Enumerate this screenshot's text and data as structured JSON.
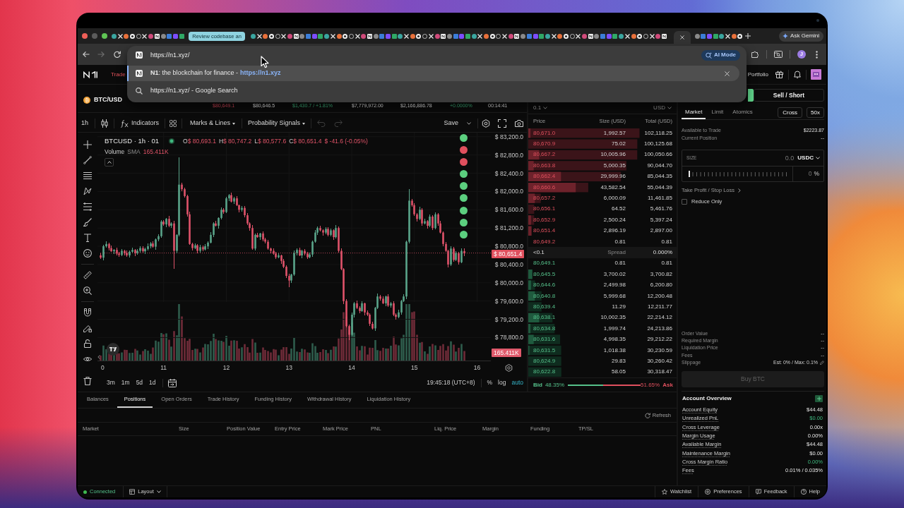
{
  "browser": {
    "tabs": [
      {
        "kind": "favicon",
        "selected": false
      },
      {
        "kind": "favicon",
        "selected": false
      },
      {
        "kind": "favicon",
        "selected": false
      },
      {
        "kind": "favicon",
        "selected": false
      },
      {
        "kind": "favicon",
        "selected": false
      },
      {
        "kind": "favicon",
        "selected": false
      },
      {
        "kind": "favicon",
        "selected": false
      },
      {
        "kind": "favicon",
        "selected": false
      },
      {
        "kind": "favicon",
        "selected": false
      },
      {
        "kind": "favicon",
        "selected": false
      },
      {
        "kind": "favicon",
        "selected": false
      },
      {
        "kind": "favicon",
        "selected": false
      },
      {
        "kind": "group",
        "label": "Review codebase an",
        "selected": false
      },
      {
        "kind": "favicon",
        "selected": false
      },
      {
        "kind": "favicon",
        "selected": false
      },
      {
        "kind": "favicon",
        "selected": false
      },
      {
        "kind": "favicon",
        "selected": false
      },
      {
        "kind": "favicon",
        "selected": false
      },
      {
        "kind": "favicon",
        "selected": false
      },
      {
        "kind": "favicon",
        "selected": false
      },
      {
        "kind": "favicon",
        "selected": false
      },
      {
        "kind": "favicon",
        "selected": false
      },
      {
        "kind": "favicon",
        "selected": false
      },
      {
        "kind": "favicon",
        "selected": false
      },
      {
        "kind": "favicon",
        "selected": false
      },
      {
        "kind": "favicon",
        "selected": false
      },
      {
        "kind": "favicon",
        "selected": false
      },
      {
        "kind": "favicon",
        "selected": false
      },
      {
        "kind": "favicon",
        "selected": false
      },
      {
        "kind": "favicon",
        "selected": false
      },
      {
        "kind": "favicon",
        "selected": false
      },
      {
        "kind": "favicon",
        "selected": false
      },
      {
        "kind": "favicon",
        "selected": false
      },
      {
        "kind": "favicon",
        "selected": false
      },
      {
        "kind": "favicon",
        "selected": false
      },
      {
        "kind": "favicon",
        "selected": false
      },
      {
        "kind": "favicon",
        "selected": false
      },
      {
        "kind": "favicon",
        "selected": false
      },
      {
        "kind": "favicon",
        "selected": false
      },
      {
        "kind": "favicon",
        "selected": false
      },
      {
        "kind": "favicon",
        "selected": false
      },
      {
        "kind": "favicon",
        "selected": false
      },
      {
        "kind": "favicon",
        "selected": false
      },
      {
        "kind": "favicon",
        "selected": false
      },
      {
        "kind": "favicon",
        "selected": false
      },
      {
        "kind": "favicon",
        "selected": false
      },
      {
        "kind": "favicon",
        "selected": false
      },
      {
        "kind": "favicon",
        "selected": false
      },
      {
        "kind": "favicon",
        "selected": false
      },
      {
        "kind": "favicon",
        "selected": false
      },
      {
        "kind": "favicon",
        "selected": false
      },
      {
        "kind": "favicon",
        "selected": false
      },
      {
        "kind": "favicon",
        "selected": false
      },
      {
        "kind": "favicon",
        "selected": false
      },
      {
        "kind": "favicon",
        "selected": false
      },
      {
        "kind": "favicon",
        "selected": false
      },
      {
        "kind": "favicon",
        "selected": false
      },
      {
        "kind": "favicon",
        "selected": false
      },
      {
        "kind": "favicon",
        "selected": false
      },
      {
        "kind": "favicon",
        "selected": false
      },
      {
        "kind": "favicon",
        "selected": false
      },
      {
        "kind": "favicon",
        "selected": false
      },
      {
        "kind": "favicon",
        "selected": false
      },
      {
        "kind": "favicon",
        "selected": false
      },
      {
        "kind": "favicon",
        "selected": false
      },
      {
        "kind": "favicon",
        "selected": false
      },
      {
        "kind": "favicon",
        "selected": false
      },
      {
        "kind": "favicon",
        "selected": false
      },
      {
        "kind": "favicon",
        "selected": false
      },
      {
        "kind": "favicon",
        "selected": false
      },
      {
        "kind": "favicon",
        "selected": false
      },
      {
        "kind": "favicon",
        "selected": false
      },
      {
        "kind": "favicon",
        "selected": false
      },
      {
        "kind": "favicon",
        "selected": false
      },
      {
        "kind": "favicon",
        "selected": false
      },
      {
        "kind": "favicon",
        "selected": false
      },
      {
        "kind": "favicon",
        "selected": false
      },
      {
        "kind": "favicon",
        "selected": false
      },
      {
        "kind": "favicon",
        "selected": false
      },
      {
        "kind": "favicon",
        "selected": false
      },
      {
        "kind": "favicon",
        "selected": false
      },
      {
        "kind": "favicon",
        "selected": true
      },
      {
        "kind": "favicon",
        "selected": false
      },
      {
        "kind": "favicon",
        "selected": false
      },
      {
        "kind": "favicon",
        "selected": false
      },
      {
        "kind": "favicon",
        "selected": false
      },
      {
        "kind": "favicon",
        "selected": false
      },
      {
        "kind": "favicon",
        "selected": false
      },
      {
        "kind": "favicon",
        "selected": false
      },
      {
        "kind": "favicon",
        "selected": false
      }
    ],
    "ask_gemini": "Ask Gemini",
    "back": {
      "disabled": false
    },
    "forward": {
      "disabled": true
    },
    "address": "https://n1.xyz/",
    "ai_mode": "AI Mode",
    "suggestions": [
      {
        "kind": "site",
        "title": "**N1**: the blockchain for finance -",
        "url": "https://n1.xyz",
        "selected": true
      },
      {
        "kind": "search",
        "title": "https://n1.xyz/ - Google Search",
        "selected": false
      }
    ],
    "profile_initial": "J"
  },
  "app_header": {
    "nav_link": {
      "label": "Trade",
      "selected": true
    },
    "portfolio_link": {
      "label": "Portfolio",
      "selected": false
    }
  },
  "market": {
    "symbol": "BTC/USD",
    "stats": [
      {
        "value": "$80,649.1",
        "kind": "down"
      },
      {
        "value": "$80,646.5",
        "kind": "plain"
      },
      {
        "value": "$1,430.7 / +1.81%",
        "kind": "up"
      },
      {
        "value": "$7,779,972.00",
        "kind": "plain"
      },
      {
        "value": "$2,166,886.78",
        "kind": "plain"
      },
      {
        "value": "+0.0000%",
        "kind": "up"
      },
      {
        "value": "00:14:41",
        "kind": "plain"
      }
    ]
  },
  "chart": {
    "toolbar": {
      "interval": "1h",
      "indicators": "Indicators",
      "marks": "Marks & Lines",
      "signals": "Probability Signals",
      "undo": {
        "disabled": true
      },
      "redo": {
        "disabled": true
      },
      "save": "Save"
    },
    "legend": {
      "title": "BTCUSD · 1h · 01",
      "ohlc": [
        {
          "label": "O",
          "value": "$ 80,693.1"
        },
        {
          "label": "H",
          "value": "$ 80,747.2"
        },
        {
          "label": "L",
          "value": "$ 80,577.6"
        },
        {
          "label": "C",
          "value": "$ 80,651.4"
        }
      ],
      "change": "$ -41.6 (-0.05%)",
      "volume": {
        "label": "Volume",
        "indicator": "SMA",
        "value": "165.411K"
      }
    },
    "signal_markers": [
      {
        "color": "#5ccf7f"
      },
      {
        "color": "#e0505e"
      },
      {
        "color": "#e0505e"
      },
      {
        "color": "#5ccf7f"
      },
      {
        "color": "#5ccf7f"
      },
      {
        "color": "#5ccf7f"
      },
      {
        "color": "#5ccf7f"
      },
      {
        "color": "#5ccf7f"
      },
      {
        "color": "#5ccf7f"
      }
    ],
    "chart_data": {
      "type": "candlestick",
      "x": [
        10,
        10.0417,
        10.0833,
        10.125,
        10.1667,
        10.2083,
        10.25,
        10.2917,
        10.3333,
        10.375,
        10.4167,
        10.4583,
        10.5,
        10.5417,
        10.5833,
        10.625,
        10.6667,
        10.7083,
        10.75,
        10.7917,
        10.8333,
        10.875,
        10.9167,
        10.9583,
        11,
        11.0417,
        11.0833,
        11.125,
        11.1667,
        11.2083,
        11.25,
        11.2917,
        11.3333,
        11.375,
        11.4167,
        11.4583,
        11.5,
        11.5417,
        11.5833,
        11.625,
        11.6667,
        11.7083,
        11.75,
        11.7917,
        11.8333,
        11.875,
        11.9167,
        11.9583,
        12,
        12.0417,
        12.0833,
        12.125,
        12.1667,
        12.2083,
        12.25,
        12.2917,
        12.3333,
        12.375,
        12.4167,
        12.4583,
        12.5,
        12.5417,
        12.5833,
        12.625,
        12.6667,
        12.7083,
        12.75,
        12.7917,
        12.8333,
        12.875,
        12.9167,
        12.9583,
        13,
        13.0417,
        13.0833,
        13.125,
        13.1667,
        13.2083,
        13.25,
        13.2917,
        13.3333,
        13.375,
        13.4167,
        13.4583,
        13.5,
        13.5417,
        13.5833,
        13.625,
        13.6667,
        13.7083,
        13.75,
        13.7917,
        13.8333,
        13.875,
        13.9167,
        13.9583,
        14,
        14.0417,
        14.0833,
        14.125,
        14.1667,
        14.2083,
        14.25,
        14.2917,
        14.3333,
        14.375,
        14.4167,
        14.4583,
        14.5,
        14.5417,
        14.5833,
        14.625,
        14.6667,
        14.7083,
        14.75,
        14.7917,
        14.8333,
        14.875,
        14.9167,
        14.9583,
        15,
        15.0417,
        15.0833,
        15.125,
        15.1667,
        15.2083,
        15.25,
        15.2917,
        15.3333,
        15.375,
        15.4167,
        15.4583,
        15.5,
        15.5417,
        15.5833,
        15.625,
        15.6667,
        15.7083,
        15.75,
        15.7917
      ],
      "ohlc": [
        [
          80600,
          80640,
          80520,
          80550
        ],
        [
          80550,
          80825,
          80495,
          80800
        ],
        [
          80800,
          80910,
          80775,
          80850
        ],
        [
          80850,
          80880,
          80715,
          80760
        ],
        [
          80760,
          80810,
          80670,
          80690
        ],
        [
          80690,
          80740,
          80630,
          80720
        ],
        [
          80720,
          80765,
          80605,
          80640
        ],
        [
          80640,
          80675,
          80570,
          80610
        ],
        [
          80610,
          80740,
          80580,
          80700
        ],
        [
          80700,
          80725,
          80595,
          80650
        ],
        [
          80650,
          80710,
          80575,
          80600
        ],
        [
          80600,
          80710,
          80555,
          80680
        ],
        [
          80680,
          80770,
          80660,
          80720
        ],
        [
          80720,
          80740,
          80590,
          80650
        ],
        [
          80650,
          80745,
          80615,
          80700
        ],
        [
          80700,
          80795,
          80660,
          80760
        ],
        [
          80760,
          80800,
          80660,
          80690
        ],
        [
          80690,
          80765,
          80635,
          80740
        ],
        [
          80740,
          80860,
          80715,
          80800
        ],
        [
          80800,
          80890,
          80755,
          80860
        ],
        [
          80860,
          80910,
          80770,
          80790
        ],
        [
          80790,
          80970,
          80730,
          80950
        ],
        [
          80950,
          81065,
          80915,
          81020
        ],
        [
          81020,
          81375,
          80980,
          81340
        ],
        [
          81340,
          81380,
          81250,
          81280
        ],
        [
          81280,
          81425,
          81225,
          81400
        ],
        [
          81400,
          81460,
          81225,
          81250
        ],
        [
          81250,
          81330,
          81205,
          81300
        ],
        [
          81300,
          81350,
          80300,
          80700
        ],
        [
          80700,
          81070,
          80640,
          81050
        ],
        [
          81050,
          82750,
          81015,
          82150
        ],
        [
          82150,
          82185,
          82010,
          82050
        ],
        [
          82050,
          82090,
          81870,
          81900
        ],
        [
          81900,
          81925,
          81445,
          81500
        ],
        [
          81500,
          81560,
          80825,
          80850
        ],
        [
          80850,
          80880,
          80715,
          80760
        ],
        [
          80760,
          80870,
          80740,
          80820
        ],
        [
          80820,
          80840,
          80640,
          80700
        ],
        [
          80700,
          80825,
          80665,
          80780
        ],
        [
          80780,
          80815,
          80690,
          80730
        ],
        [
          80730,
          80840,
          80700,
          80800
        ],
        [
          80800,
          80905,
          80745,
          80880
        ],
        [
          80880,
          81110,
          80855,
          81050
        ],
        [
          81050,
          81330,
          81005,
          81300
        ],
        [
          81300,
          81350,
          81230,
          81250
        ],
        [
          81250,
          81440,
          81190,
          81420
        ],
        [
          81420,
          81645,
          81385,
          81600
        ],
        [
          81600,
          81635,
          81510,
          81550
        ],
        [
          81550,
          81890,
          81520,
          81850
        ],
        [
          81850,
          81945,
          81795,
          81920
        ],
        [
          81920,
          81980,
          81755,
          81780
        ],
        [
          81780,
          81880,
          81735,
          81850
        ],
        [
          81850,
          81900,
          81680,
          81700
        ],
        [
          81700,
          81720,
          81540,
          81600
        ],
        [
          81600,
          81685,
          81565,
          81640
        ],
        [
          81640,
          81675,
          81440,
          81480
        ],
        [
          81480,
          81520,
          81270,
          81300
        ],
        [
          81300,
          81325,
          81145,
          81200
        ],
        [
          81200,
          81260,
          80725,
          80750
        ],
        [
          80750,
          81080,
          80705,
          81050
        ],
        [
          81050,
          81100,
          80980,
          81000
        ],
        [
          81000,
          81100,
          80940,
          81080
        ],
        [
          81080,
          81125,
          80915,
          80950
        ],
        [
          80950,
          80985,
          80860,
          80900
        ],
        [
          80900,
          80940,
          80720,
          80750
        ],
        [
          80750,
          80775,
          80645,
          80700
        ],
        [
          80700,
          80760,
          80615,
          80640
        ],
        [
          80640,
          80670,
          80515,
          80560
        ],
        [
          80560,
          80650,
          80540,
          80600
        ],
        [
          80600,
          80620,
          80420,
          80480
        ],
        [
          80480,
          80525,
          80315,
          80350
        ],
        [
          80350,
          80385,
          80110,
          80150
        ],
        [
          80150,
          80190,
          79900,
          80050
        ],
        [
          80050,
          80205,
          79995,
          80180
        ],
        [
          80180,
          80710,
          80155,
          80650
        ],
        [
          80650,
          80750,
          80605,
          80720
        ],
        [
          80720,
          80770,
          80580,
          80600
        ],
        [
          80600,
          80720,
          80540,
          80700
        ],
        [
          80700,
          80745,
          80605,
          80640
        ],
        [
          80640,
          80675,
          80520,
          80560
        ],
        [
          80560,
          80660,
          80530,
          80620
        ],
        [
          80620,
          80925,
          80565,
          80900
        ],
        [
          80900,
          81160,
          80875,
          81100
        ],
        [
          81100,
          81230,
          81055,
          81200
        ],
        [
          81200,
          81250,
          81130,
          81150
        ],
        [
          81150,
          81170,
          81040,
          81100
        ],
        [
          81100,
          81225,
          81065,
          81180
        ],
        [
          81180,
          81215,
          81010,
          81050
        ],
        [
          81050,
          81190,
          81020,
          81150
        ],
        [
          81150,
          81175,
          80945,
          81000
        ],
        [
          81000,
          81260,
          80975,
          81200
        ],
        [
          81200,
          81230,
          80655,
          80700
        ],
        [
          80700,
          80750,
          80280,
          80300
        ],
        [
          80300,
          80320,
          79540,
          79600
        ],
        [
          79600,
          79645,
          79015,
          79050
        ],
        [
          79050,
          79085,
          78750,
          78860
        ],
        [
          78860,
          79340,
          78830,
          79300
        ],
        [
          79300,
          79575,
          79245,
          79550
        ],
        [
          79550,
          79610,
          79425,
          79450
        ],
        [
          79450,
          79480,
          79335,
          79380
        ],
        [
          79380,
          79600,
          79360,
          79550
        ],
        [
          79550,
          79570,
          79290,
          79350
        ],
        [
          79350,
          79395,
          79265,
          79300
        ],
        [
          79300,
          79335,
          79060,
          79100
        ],
        [
          79100,
          79140,
          78970,
          79000
        ],
        [
          79000,
          79475,
          78945,
          79450
        ],
        [
          79450,
          79760,
          79425,
          79700
        ],
        [
          79700,
          79730,
          79605,
          79650
        ],
        [
          79650,
          79700,
          79530,
          79550
        ],
        [
          79550,
          79720,
          79490,
          79700
        ],
        [
          79700,
          79745,
          79465,
          79500
        ],
        [
          79500,
          79585,
          79460,
          79550
        ],
        [
          79550,
          79590,
          79270,
          79300
        ],
        [
          79300,
          79325,
          79195,
          79250
        ],
        [
          79250,
          79410,
          79225,
          79350
        ],
        [
          79350,
          79630,
          79305,
          79600
        ],
        [
          79600,
          79750,
          79580,
          79700
        ],
        [
          79700,
          80920,
          79640,
          80900
        ],
        [
          80900,
          82050,
          80865,
          81800
        ],
        [
          81800,
          81835,
          81660,
          81700
        ],
        [
          81700,
          81740,
          81470,
          81500
        ],
        [
          81500,
          81525,
          81345,
          81400
        ],
        [
          81400,
          81660,
          81375,
          81600
        ],
        [
          81600,
          81630,
          81255,
          81300
        ],
        [
          81300,
          81400,
          81280,
          81350
        ],
        [
          81350,
          81370,
          81190,
          81250
        ],
        [
          81250,
          81495,
          81215,
          81450
        ],
        [
          81450,
          81485,
          81160,
          81200
        ],
        [
          81200,
          81540,
          81170,
          81500
        ],
        [
          81500,
          81525,
          81245,
          81300
        ],
        [
          81300,
          81360,
          81075,
          81100
        ],
        [
          81100,
          81130,
          80805,
          80850
        ],
        [
          80850,
          80900,
          80680,
          80700
        ],
        [
          80700,
          80720,
          80340,
          80400
        ],
        [
          80400,
          80795,
          80365,
          80750
        ],
        [
          80750,
          80785,
          80460,
          80500
        ],
        [
          80500,
          80690,
          80470,
          80650
        ],
        [
          80650,
          80675,
          80395,
          80450
        ],
        [
          80450,
          80760,
          80425,
          80700
        ],
        [
          80693.1,
          80747.2,
          80577.6,
          80651.4
        ]
      ],
      "xlim": [
        9.9438,
        16.2196
      ],
      "ylim": [
        78280,
        83290
      ],
      "grid": true,
      "ref_lines": [
        {
          "axis": "y",
          "value": 80651.4,
          "label": "$ 80,651.4"
        }
      ],
      "xticks": [
        {
          "value": 11,
          "label": "11"
        },
        {
          "value": 12,
          "label": "12"
        },
        {
          "value": 13,
          "label": "13"
        },
        {
          "value": 14,
          "label": "14"
        },
        {
          "value": 15,
          "label": "15"
        },
        {
          "value": 16,
          "label": "16"
        }
      ],
      "yticks": [
        {
          "value": 83200,
          "label": "$ 83,200.0"
        },
        {
          "value": 82800,
          "label": "$ 82,800.0"
        },
        {
          "value": 82400,
          "label": "$ 82,400.0"
        },
        {
          "value": 82000,
          "label": "$ 82,000.0"
        },
        {
          "value": 81600,
          "label": "$ 81,600.0"
        },
        {
          "value": 81200,
          "label": "$ 81,200.0"
        },
        {
          "value": 80800,
          "label": "$ 80,800.0"
        },
        {
          "value": 80400,
          "label": "$ 80,400.0"
        },
        {
          "value": 80000,
          "label": "$ 80,000.0"
        },
        {
          "value": 79600,
          "label": "$ 79,600.0"
        },
        {
          "value": 79200,
          "label": "$ 79,200.0"
        },
        {
          "value": 78800,
          "label": "$ 78,800.0"
        }
      ]
    },
    "cut_axis_label": "0",
    "last_volume": "165.411K",
    "ranges": [
      "3m",
      "1m",
      "5d",
      "1d"
    ],
    "clock": "19:45:18 (UTC+8)",
    "scale_options": [
      {
        "label": "%",
        "on": false
      },
      {
        "label": "log",
        "on": false
      },
      {
        "label": "auto",
        "on": true
      }
    ]
  },
  "order_book": {
    "tick": "0.1",
    "currency": "USD",
    "columns": [
      "Price",
      "Size (USD)",
      "Total (USD)"
    ],
    "asks": [
      {
        "price": "80,671.0",
        "size": "1,992.57",
        "total": "102,118.25"
      },
      {
        "price": "80,670.9",
        "size": "75.02",
        "total": "100,125.68"
      },
      {
        "price": "80,667.2",
        "size": "10,005.96",
        "total": "100,050.66"
      },
      {
        "price": "80,663.8",
        "size": "5,000.35",
        "total": "90,044.70"
      },
      {
        "price": "80,662.4",
        "size": "29,999.96",
        "total": "85,044.35"
      },
      {
        "price": "80,660.6",
        "size": "43,582.54",
        "total": "55,044.39"
      },
      {
        "price": "80,657.2",
        "size": "6,000.09",
        "total": "11,461.85"
      },
      {
        "price": "80,656.1",
        "size": "64.52",
        "total": "5,461.76"
      },
      {
        "price": "80,652.9",
        "size": "2,500.24",
        "total": "5,397.24"
      },
      {
        "price": "80,651.4",
        "size": "2,896.19",
        "total": "2,897.00"
      },
      {
        "price": "80,649.2",
        "size": "0.81",
        "total": "0.81"
      }
    ],
    "spread": {
      "value": "<0.1",
      "label": "Spread",
      "percent": "0.000%"
    },
    "bids": [
      {
        "price": "80,649.1",
        "size": "0.81",
        "total": "0.81"
      },
      {
        "price": "80,645.5",
        "size": "3,700.02",
        "total": "3,700.82"
      },
      {
        "price": "80,644.6",
        "size": "2,499.98",
        "total": "6,200.80"
      },
      {
        "price": "80,640.8",
        "size": "5,999.68",
        "total": "12,200.48"
      },
      {
        "price": "80,639.4",
        "size": "11.29",
        "total": "12,211.77"
      },
      {
        "price": "80,638.1",
        "size": "10,002.35",
        "total": "22,214.12"
      },
      {
        "price": "80,634.8",
        "size": "1,999.74",
        "total": "24,213.86"
      },
      {
        "price": "80,631.6",
        "size": "4,998.35",
        "total": "29,212.22"
      },
      {
        "price": "80,631.5",
        "size": "1,018.38",
        "total": "30,230.59"
      },
      {
        "price": "80,624.9",
        "size": "29.83",
        "total": "30,260.42"
      },
      {
        "price": "80,622.8",
        "size": "58.05",
        "total": "30,318.47"
      }
    ],
    "ratio": {
      "bid_label": "Bid",
      "bid_share": "48.35%",
      "ask_share": "51.65%",
      "ask_label": "Ask",
      "level": 0.4835
    }
  },
  "trade_panel": {
    "sides": [
      {
        "kind": "buy",
        "selected": true
      },
      {
        "kind": "sell",
        "label": "Sell / Short",
        "selected": false
      }
    ],
    "order_types": [
      {
        "label": "Market",
        "selected": true
      },
      {
        "label": "Limit",
        "selected": false
      },
      {
        "label": "Atomics",
        "selected": false
      }
    ],
    "margin_mode": "Cross",
    "leverage": "50x",
    "info": [
      {
        "label": "Available to Trade",
        "value": "$2223.87"
      },
      {
        "label": "Current Position",
        "value": "--"
      }
    ],
    "size": {
      "label": "SIZE",
      "placeholder": "0.0",
      "unit": "USDC",
      "slider": {
        "level": 0
      },
      "percent": {
        "placeholder": "0",
        "unit": "%"
      }
    },
    "tpsl": "Take Profit / Stop Loss",
    "reduce_only": {
      "label": "Reduce Only",
      "checked": false
    },
    "summary": [
      {
        "kind": "plain",
        "label": "Order Value",
        "value": "--"
      },
      {
        "kind": "plain",
        "label": "Required Margin",
        "value": "--"
      },
      {
        "kind": "plain",
        "label": "Liquidation Price",
        "value": "--"
      },
      {
        "kind": "plain",
        "label": "Fees",
        "value": "--"
      },
      {
        "kind": "editable",
        "label": "Slippage",
        "value": "Est: 0% / Max: 0.1%"
      }
    ],
    "submit": {
      "label": "Buy BTC",
      "disabled": true
    },
    "account": {
      "title": "Account Overview",
      "rows": [
        {
          "label": "Account Equity",
          "value": "$44.48",
          "kind": "plain"
        },
        {
          "label": "Unrealized PnL",
          "value": "$0.00",
          "kind": "gain"
        },
        {
          "label": "Cross Leverage",
          "value": "0.00x",
          "kind": "plain"
        },
        {
          "label": "Margin Usage",
          "value": "0.00%",
          "kind": "plain"
        },
        {
          "label": "Available Margin",
          "value": "$44.48",
          "kind": "plain"
        },
        {
          "label": "Maintenance Margin",
          "value": "$0.00",
          "kind": "plain"
        },
        {
          "label": "Cross Margin Ratio",
          "value": "0.00%",
          "kind": "gain"
        },
        {
          "label": "Fees",
          "value": "0.01% / 0.035%",
          "kind": "plain"
        }
      ]
    }
  },
  "positions_panel": {
    "tabs": [
      {
        "label": "Balances",
        "selected": false
      },
      {
        "label": "Positions",
        "selected": true
      },
      {
        "label": "Open Orders",
        "selected": false
      },
      {
        "label": "Trade History",
        "selected": false
      },
      {
        "label": "Funding History",
        "selected": false
      },
      {
        "label": "Withdrawal History",
        "selected": false
      },
      {
        "label": "Liquidation History",
        "selected": false
      }
    ],
    "refresh": "Refresh",
    "columns": [
      "Market",
      "Size",
      "Position Value",
      "Entry Price",
      "Mark Price",
      "PNL",
      "Liq. Price",
      "Margin",
      "Funding",
      "TP/SL"
    ]
  },
  "status_bar": {
    "connection": {
      "label": "Connected",
      "color": "#3fb950"
    },
    "layout": "Layout",
    "links": [
      {
        "kind": "watchlist",
        "label": "Watchlist"
      },
      {
        "kind": "preferences",
        "label": "Preferences"
      },
      {
        "kind": "feedback",
        "label": "Feedback"
      },
      {
        "kind": "help",
        "label": "Help"
      }
    ]
  }
}
